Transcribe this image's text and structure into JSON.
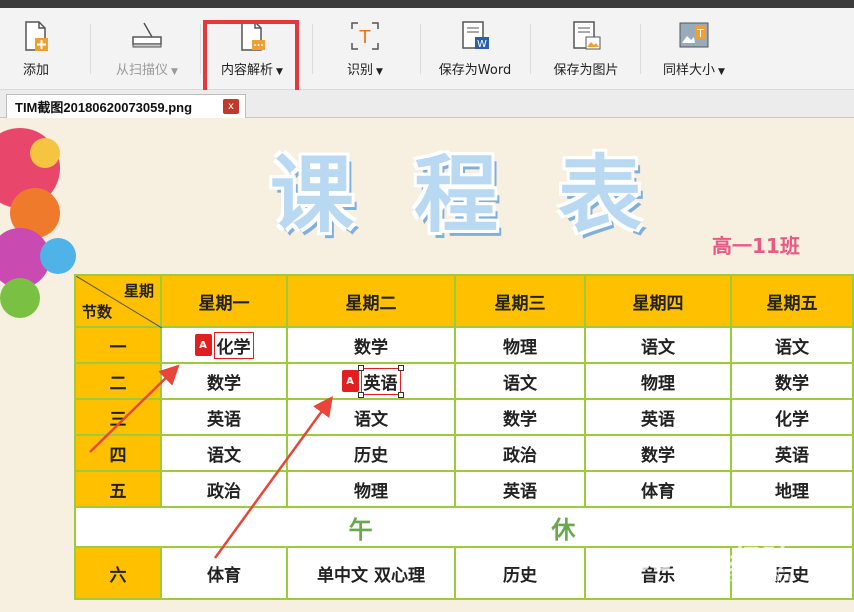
{
  "toolbar": {
    "add": "添加",
    "scanner": "从扫描仪",
    "content_parse": "内容解析",
    "recognize": "识别",
    "save_word": "保存为Word",
    "save_image": "保存为图片",
    "same_size": "同样大小"
  },
  "tab": {
    "title": "TIM截图20180620073059.png",
    "close": "x"
  },
  "schedule": {
    "title_chars": [
      "课",
      "程",
      "表"
    ],
    "class_name": "高一11班",
    "corner_top": "星期",
    "corner_bottom": "节数",
    "days": [
      "星期一",
      "星期二",
      "星期三",
      "星期四",
      "星期五"
    ],
    "rows": [
      {
        "period": "一",
        "cells": [
          "化学",
          "数学",
          "物理",
          "语文",
          "语文"
        ]
      },
      {
        "period": "二",
        "cells": [
          "数学",
          "英语",
          "语文",
          "物理",
          "数学"
        ]
      },
      {
        "period": "三",
        "cells": [
          "英语",
          "语文",
          "数学",
          "英语",
          "化学"
        ]
      },
      {
        "period": "四",
        "cells": [
          "语文",
          "历史",
          "政治",
          "数学",
          "英语"
        ]
      },
      {
        "period": "五",
        "cells": [
          "政治",
          "物理",
          "英语",
          "体育",
          "地理"
        ]
      }
    ],
    "noon": [
      "午",
      "休"
    ],
    "row6": {
      "period": "六",
      "cells": [
        "体育",
        "单中文  双心理",
        "历史",
        "音乐",
        "历史"
      ]
    }
  },
  "watermark": {
    "text": "Baidu经验",
    "sub": "jingyan.baidu.com"
  },
  "colors": {
    "highlight": "#e23a3a",
    "header": "#ffc000",
    "grid": "#9ccc3c"
  }
}
